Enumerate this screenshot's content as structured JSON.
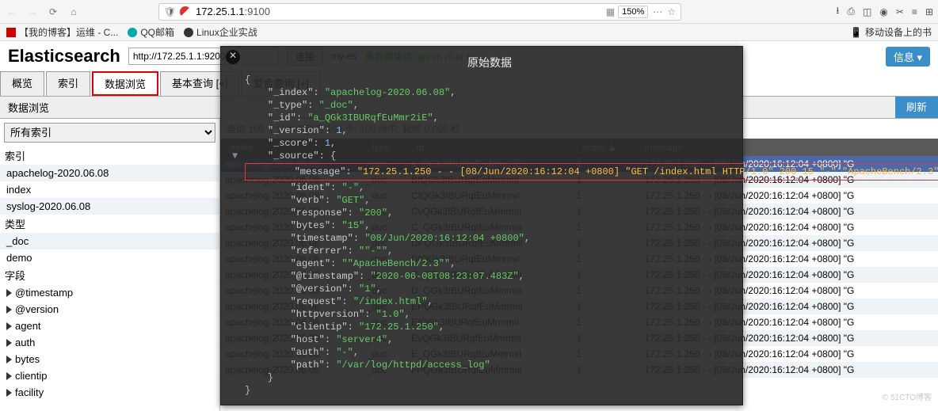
{
  "browser": {
    "url_prefix": "172.25.1.1",
    "url_port": ":9100",
    "zoom": "150%",
    "bookmarks": [
      {
        "icon": "redbox",
        "label": "【我的博客】运维 - C..."
      },
      {
        "icon": "qq",
        "label": "QQ邮箱"
      },
      {
        "icon": "tux",
        "label": "Linux企业实战"
      }
    ],
    "mobile_bookmark": "移动设备上的书"
  },
  "header": {
    "title": "Elasticsearch",
    "url_input": "http://172.25.1.1:9200/",
    "connect_btn": "连接",
    "cluster": "my-es",
    "health": "集群健康值: green (6 of 6)",
    "info_btn": "信息 ▾"
  },
  "tabs": [
    {
      "label": "概览"
    },
    {
      "label": "索引"
    },
    {
      "label": "数据浏览",
      "selected": true,
      "boxed": true
    },
    {
      "label": "基本查询 [+]"
    },
    {
      "label": "复合查询 [+]"
    }
  ],
  "subbar": {
    "title": "数据浏览",
    "refresh": "刷新"
  },
  "sidebar": {
    "all_indices": "所有索引",
    "index_label": "索引",
    "indices": [
      {
        "name": "apachelog-2020.06.08",
        "boxed": true
      },
      {
        "name": "index"
      },
      {
        "name": "syslog-2020.06.08"
      }
    ],
    "type_label": "类型",
    "types": [
      "_doc",
      "demo"
    ],
    "field_label": "字段",
    "fields": [
      "@timestamp",
      "@version",
      "agent",
      "auth",
      "bytes",
      "clientip",
      "facility"
    ]
  },
  "results": {
    "hint": "查询 100 个分片中用的 100 个. 100 命中. 耗时 0.006 秒",
    "headers": [
      "_index",
      "_type",
      "_id",
      "_score",
      "message"
    ],
    "sort_col": "_score",
    "rows": [
      {
        "index": "apachelog-2020.06.08",
        "type": "_doc",
        "id": "a_QGk3IBURqfEuMmr2iE",
        "score": "1",
        "msg": "172.25.1.250 - - [08/Jun/2020:16:12:04 +0800] \"G",
        "sel": true
      },
      {
        "index": "apachelog-2020.06.08",
        "type": "_doc",
        "id": "BfQGk3IBURqfEuMmrmiI",
        "score": "1",
        "msg": "172.25.1.250 - - [08/Jun/2020:16:12:04 +0800] \"G"
      },
      {
        "index": "apachelog-2020.06.08",
        "type": "_doc",
        "id": "CfQGk3IBURqfEuMmrmiI",
        "score": "1",
        "msg": "172.25.1.250 - - [08/Jun/2020:16:12:04 +0800] \"G"
      },
      {
        "index": "apachelog-2020.06.08",
        "type": "_doc",
        "id": "CvQGk3IBURqfEuMmrmiI",
        "score": "1",
        "msg": "172.25.1.250 - - [08/Jun/2020:16:12:04 +0800] \"G"
      },
      {
        "index": "apachelog-2020.06.08",
        "type": "_doc",
        "id": "C_QGk3IBURqfEuMmrmiI",
        "score": "1",
        "msg": "172.25.1.250 - - [08/Jun/2020:16:12:04 +0800] \"G"
      },
      {
        "index": "apachelog-2020.06.08",
        "type": "_doc",
        "id": "DPQGk3IBURqfEuMmrmiI",
        "score": "1",
        "msg": "172.25.1.250 - - [08/Jun/2020:16:12:04 +0800] \"G"
      },
      {
        "index": "apachelog-2020.06.08",
        "type": "_doc",
        "id": "DfQGk3IBURqfEuMmrmiI",
        "score": "1",
        "msg": "172.25.1.250 - - [08/Jun/2020:16:12:04 +0800] \"G"
      },
      {
        "index": "apachelog-2020.06.08",
        "type": "_doc",
        "id": "C_QGk3IBURqfEuMmrmiI",
        "score": "1",
        "msg": "172.25.1.250 - - [08/Jun/2020:16:12:04 +0800] \"G"
      },
      {
        "index": "apachelog-2020.06.08",
        "type": "_doc",
        "id": "D_QGk3IBURqfEuMmrmiI",
        "score": "1",
        "msg": "172.25.1.250 - - [08/Jun/2020:16:12:04 +0800] \"G"
      },
      {
        "index": "apachelog-2020.06.08",
        "type": "_doc",
        "id": "EPQGk3IBURqfEuMmrmiI",
        "score": "1",
        "msg": "172.25.1.250 - - [08/Jun/2020:16:12:04 +0800] \"G"
      },
      {
        "index": "apachelog-2020.06.08",
        "type": "_doc",
        "id": "EfQGk3IBURqfEuMmrmiI",
        "score": "1",
        "msg": "172.25.1.250 - - [08/Jun/2020:16:12:04 +0800] \"G"
      },
      {
        "index": "apachelog-2020.06.08",
        "type": "_doc",
        "id": "EvQGk3IBURqfEuMmrmiI",
        "score": "1",
        "msg": "172.25.1.250 - - [08/Jun/2020:16:12:04 +0800] \"G"
      },
      {
        "index": "apachelog-2020.06.08",
        "type": "_doc",
        "id": "E_QGk3IBURqfEuMmrmiI",
        "score": "1",
        "msg": "172.25.1.250 - - [08/Jun/2020:16:12:04 +0800] \"G"
      },
      {
        "index": "apachelog-2020.06.08",
        "type": "_doc",
        "id": "FPQGk3IBURqfEuMmrmiI",
        "score": "1",
        "msg": "172.25.1.250 - - [08/Jun/2020:16:12:04 +0800] \"G"
      }
    ]
  },
  "overlay": {
    "title": "原始数据",
    "json": {
      "_index": "apachelog-2020.06.08",
      "_type": "_doc",
      "_id": "a_QGk3IBURqfEuMmr2iE",
      "_version": 1,
      "_score": 1,
      "_source": {
        "message": "172.25.1.250 - - [08/Jun/2020:16:12:04 +0800] \"GET /index.html HTTP/1.0\" 200 15 \"-\" \"ApacheBench/2.3\"\"",
        "ident": "-",
        "verb": "GET",
        "response": "200",
        "bytes": "15",
        "timestamp": "08/Jun/2020:16:12:04 +0800",
        "referrer": "\"-\"",
        "agent": "\"ApacheBench/2.3\"",
        "@timestamp": "2020-06-08T08:23:07.483Z",
        "@version": "1",
        "request": "/index.html",
        "httpversion": "1.0",
        "clientip": "172.25.1.250",
        "host": "server4",
        "auth": "-",
        "path": "/var/log/httpd/access_log"
      }
    }
  },
  "watermark": "© 51CTO博客"
}
